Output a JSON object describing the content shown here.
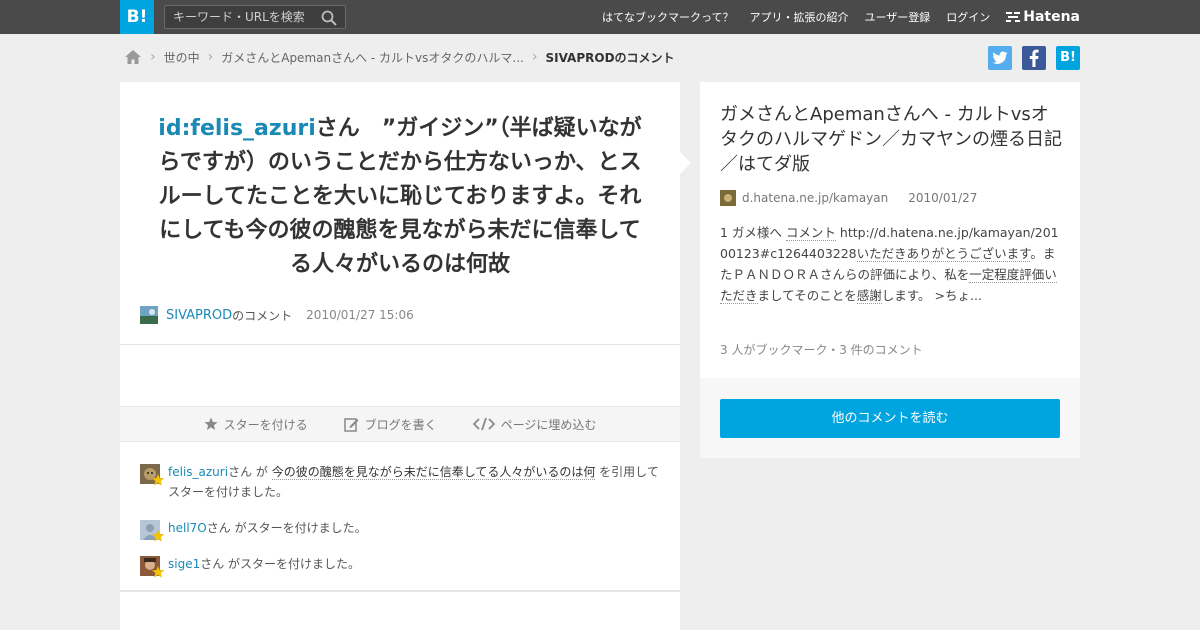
{
  "topbar": {
    "logo": "B!",
    "search_placeholder": "キーワード・URLを検索",
    "nav": [
      "はてなブックマークって？",
      "アプリ・拡張の紹介",
      "ユーザー登録",
      "ログイン"
    ],
    "brand": "Hatena"
  },
  "breadcrumb": {
    "items": [
      "世の中",
      "ガメさんとApemanさんへ - カルトvsオタクのハルマ..."
    ],
    "current": "SIVAPRODのコメント"
  },
  "share": {
    "twitter": "t",
    "facebook": "f",
    "hatena": "B!"
  },
  "comment": {
    "user_id": "id:felis_azuri",
    "text": "さん　”ガイジン”（半ば疑いながらですが）のいうことだから仕方ないっか、とスルーしてたことを大いに恥じておりますよ。それにしても今の彼の醜態を見ながら未だに信奉してる人々がいるのは何故",
    "author": "SIVAPROD",
    "author_suffix": "のコメント",
    "date": "2010/01/27 15:06"
  },
  "actions": {
    "star": "スターを付ける",
    "blog": "ブログを書く",
    "embed": "ページに埋め込む"
  },
  "stars": [
    {
      "user": "felis_azuri",
      "mid": "さん が ",
      "quote": "今の彼の醜態を見ながら未だに信奉してる人々がいるのは何",
      "tail": " を引用してスターを付けました。"
    },
    {
      "user": "hell7O",
      "mid": "さん がスターを付けました。"
    },
    {
      "user": "sige1",
      "mid": "さん がスターを付けました。"
    }
  ],
  "entry": {
    "title": "ガメさんとApemanさんへ - カルトvsオタクのハルマゲドン／カマヤンの煙る日記／はてダ版",
    "domain": "d.hatena.ne.jp/kamayan",
    "date": "2010/01/27",
    "summary": {
      "p1": "1 ガメ様へ ",
      "l1": "コメント",
      "p2": " http://d.hatena.ne.jp/kamayan/20100123#c1264403228",
      "l2": "いただきありがとうございます",
      "p3": "。またＰＡＮＤＯＲＡさんらの評価により、私を",
      "l3": "一定程度評価いただき",
      "p4": "ましてそのことを",
      "l4": "感謝",
      "p5": "します。 >ちょ..."
    },
    "counts": "3 人がブックマーク・3 件のコメント",
    "read_button": "他のコメントを読む"
  },
  "colors": {
    "accent": "#00a4de",
    "link": "#1a8ab5",
    "topbar": "#4a4a4a"
  }
}
